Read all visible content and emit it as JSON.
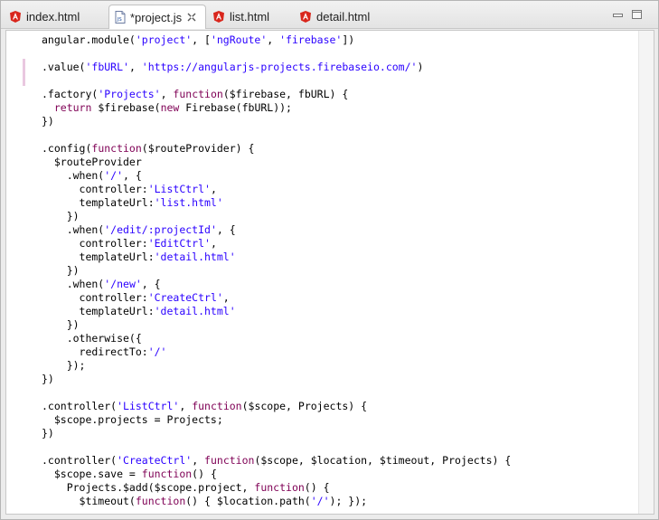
{
  "tabs": [
    {
      "label": "index.html",
      "icon": "angular-icon",
      "active": false
    },
    {
      "label": "*project.js",
      "icon": "js-file-icon",
      "active": true
    },
    {
      "label": "list.html",
      "icon": "angular-icon",
      "active": false
    },
    {
      "label": "detail.html",
      "icon": "angular-icon",
      "active": false
    }
  ],
  "colors": {
    "keyword": "#7f0055",
    "string": "#2a00ff",
    "angular_red": "#d9261c"
  },
  "code_lines": [
    [
      [
        "angular.module(",
        ""
      ],
      [
        "'project'",
        "s"
      ],
      [
        ", [",
        ""
      ],
      [
        "'ngRoute'",
        "s"
      ],
      [
        ", ",
        ""
      ],
      [
        "'firebase'",
        "s"
      ],
      [
        "])",
        ""
      ]
    ],
    [],
    [
      [
        ".value(",
        ""
      ],
      [
        "'fbURL'",
        "s"
      ],
      [
        ", ",
        ""
      ],
      [
        "'https://angularjs-projects.firebaseio.com/'",
        "s"
      ],
      [
        ")",
        ""
      ]
    ],
    [],
    [
      [
        ".factory(",
        ""
      ],
      [
        "'Projects'",
        "s"
      ],
      [
        ", ",
        ""
      ],
      [
        "function",
        "k"
      ],
      [
        "($firebase, fbURL) {",
        ""
      ]
    ],
    [
      [
        "  ",
        ""
      ],
      [
        "return",
        "k"
      ],
      [
        " $firebase(",
        ""
      ],
      [
        "new",
        "k"
      ],
      [
        " Firebase(fbURL));",
        ""
      ]
    ],
    [
      [
        "})",
        ""
      ]
    ],
    [],
    [
      [
        ".config(",
        ""
      ],
      [
        "function",
        "k"
      ],
      [
        "($routeProvider) {",
        ""
      ]
    ],
    [
      [
        "  $routeProvider",
        ""
      ]
    ],
    [
      [
        "    .when(",
        ""
      ],
      [
        "'/'",
        "s"
      ],
      [
        ", {",
        ""
      ]
    ],
    [
      [
        "      controller:",
        ""
      ],
      [
        "'ListCtrl'",
        "s"
      ],
      [
        ",",
        ""
      ]
    ],
    [
      [
        "      templateUrl:",
        ""
      ],
      [
        "'list.html'",
        "s"
      ]
    ],
    [
      [
        "    })",
        ""
      ]
    ],
    [
      [
        "    .when(",
        ""
      ],
      [
        "'/edit/:projectId'",
        "s"
      ],
      [
        ", {",
        ""
      ]
    ],
    [
      [
        "      controller:",
        ""
      ],
      [
        "'EditCtrl'",
        "s"
      ],
      [
        ",",
        ""
      ]
    ],
    [
      [
        "      templateUrl:",
        ""
      ],
      [
        "'detail.html'",
        "s"
      ]
    ],
    [
      [
        "    })",
        ""
      ]
    ],
    [
      [
        "    .when(",
        ""
      ],
      [
        "'/new'",
        "s"
      ],
      [
        ", {",
        ""
      ]
    ],
    [
      [
        "      controller:",
        ""
      ],
      [
        "'CreateCtrl'",
        "s"
      ],
      [
        ",",
        ""
      ]
    ],
    [
      [
        "      templateUrl:",
        ""
      ],
      [
        "'detail.html'",
        "s"
      ]
    ],
    [
      [
        "    })",
        ""
      ]
    ],
    [
      [
        "    .otherwise({",
        ""
      ]
    ],
    [
      [
        "      redirectTo:",
        ""
      ],
      [
        "'/'",
        "s"
      ]
    ],
    [
      [
        "    });",
        ""
      ]
    ],
    [
      [
        "})",
        ""
      ]
    ],
    [],
    [
      [
        ".controller(",
        ""
      ],
      [
        "'ListCtrl'",
        "s"
      ],
      [
        ", ",
        ""
      ],
      [
        "function",
        "k"
      ],
      [
        "($scope, Projects) {",
        ""
      ]
    ],
    [
      [
        "  $scope.projects = Projects;",
        ""
      ]
    ],
    [
      [
        "})",
        ""
      ]
    ],
    [],
    [
      [
        ".controller(",
        ""
      ],
      [
        "'CreateCtrl'",
        "s"
      ],
      [
        ", ",
        ""
      ],
      [
        "function",
        "k"
      ],
      [
        "($scope, $location, $timeout, Projects) {",
        ""
      ]
    ],
    [
      [
        "  $scope.save = ",
        ""
      ],
      [
        "function",
        "k"
      ],
      [
        "() {",
        ""
      ]
    ],
    [
      [
        "    Projects.$add($scope.project, ",
        ""
      ],
      [
        "function",
        "k"
      ],
      [
        "() {",
        ""
      ]
    ],
    [
      [
        "      $timeout(",
        ""
      ],
      [
        "function",
        "k"
      ],
      [
        "() { $location.path(",
        ""
      ],
      [
        "'/'",
        "s"
      ],
      [
        "); });",
        ""
      ]
    ]
  ]
}
